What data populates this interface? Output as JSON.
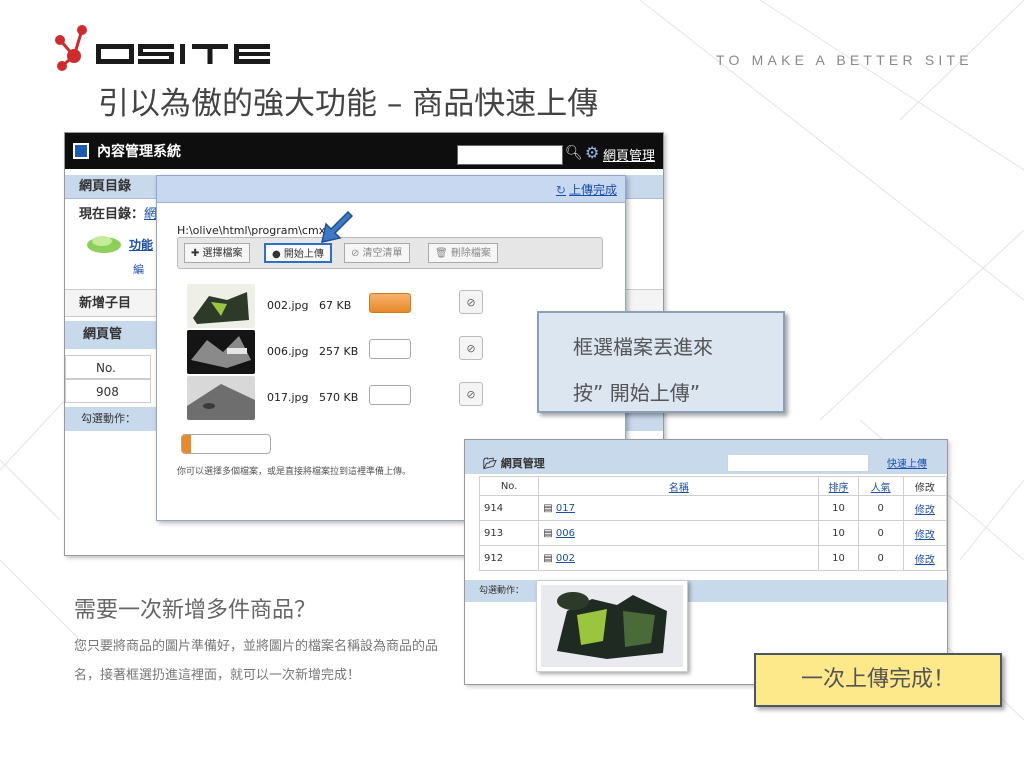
{
  "brand": {
    "logo_text": "QSITE",
    "tagline": "TO MAKE A BETTER SITE"
  },
  "headline": "引以為傲的強大功能 – 商品快速上傳",
  "cms": {
    "title": "內容管理系統",
    "manage_link": "網頁管理",
    "dir_bar": "網頁目錄",
    "current_dir_label": "現在目錄：",
    "current_dir_link": "網",
    "func_link": "功能",
    "func_sub": "編",
    "add_sub": "新增子目",
    "page_mgmt": "網頁管",
    "col_no": "No.",
    "row_no": "908",
    "batch_action": "勾選動作："
  },
  "upload": {
    "done_link": "上傳完成",
    "path": "H:\\olive\\html\\program\\cmx",
    "buttons": {
      "select": "✚ 選擇檔案",
      "start": "開始上傳",
      "clear": "⊘ 清空清單",
      "delete": "🗑 刪除檔案"
    },
    "files": [
      {
        "name": "002.jpg",
        "size": "67 KB",
        "progress": 1.0
      },
      {
        "name": "006.jpg",
        "size": "257 KB",
        "progress": 0
      },
      {
        "name": "017.jpg",
        "size": "570 KB",
        "progress": 0
      }
    ],
    "remove_glyph": "⊘",
    "total_progress": 0.1,
    "hint": "你可以選擇多個檔案，或是直接將檔案拉到這裡準備上傳。"
  },
  "callout": {
    "line1": "框選檔案丟進來",
    "line2": "按” 開始上傳”"
  },
  "result": {
    "title": "網頁管理",
    "quick_upload": "快速上傳",
    "headers": {
      "no": "No.",
      "name": "名稱",
      "order": "排序",
      "views": "人氣",
      "edit": "修改"
    },
    "rows": [
      {
        "no": "914",
        "name": "017",
        "order": "10",
        "views": "0",
        "edit": "修改"
      },
      {
        "no": "913",
        "name": "006",
        "order": "10",
        "views": "0",
        "edit": "修改"
      },
      {
        "no": "912",
        "name": "002",
        "order": "10",
        "views": "0",
        "edit": "修改"
      }
    ],
    "batch_action": "勾選動作："
  },
  "question": "需要一次新增多件商品？",
  "description": "您只要將商品的圖片準備好，並將圖片的檔案名稱設為商品的品名，接著框選扔進這裡面，就可以一次新增完成！",
  "done_banner": "一次上傳完成！",
  "colors": {
    "accent_orange": "#e8892a",
    "panel_blue": "#c9d9ec",
    "done_yellow": "#fde88a",
    "brand_red": "#d12a2a"
  }
}
